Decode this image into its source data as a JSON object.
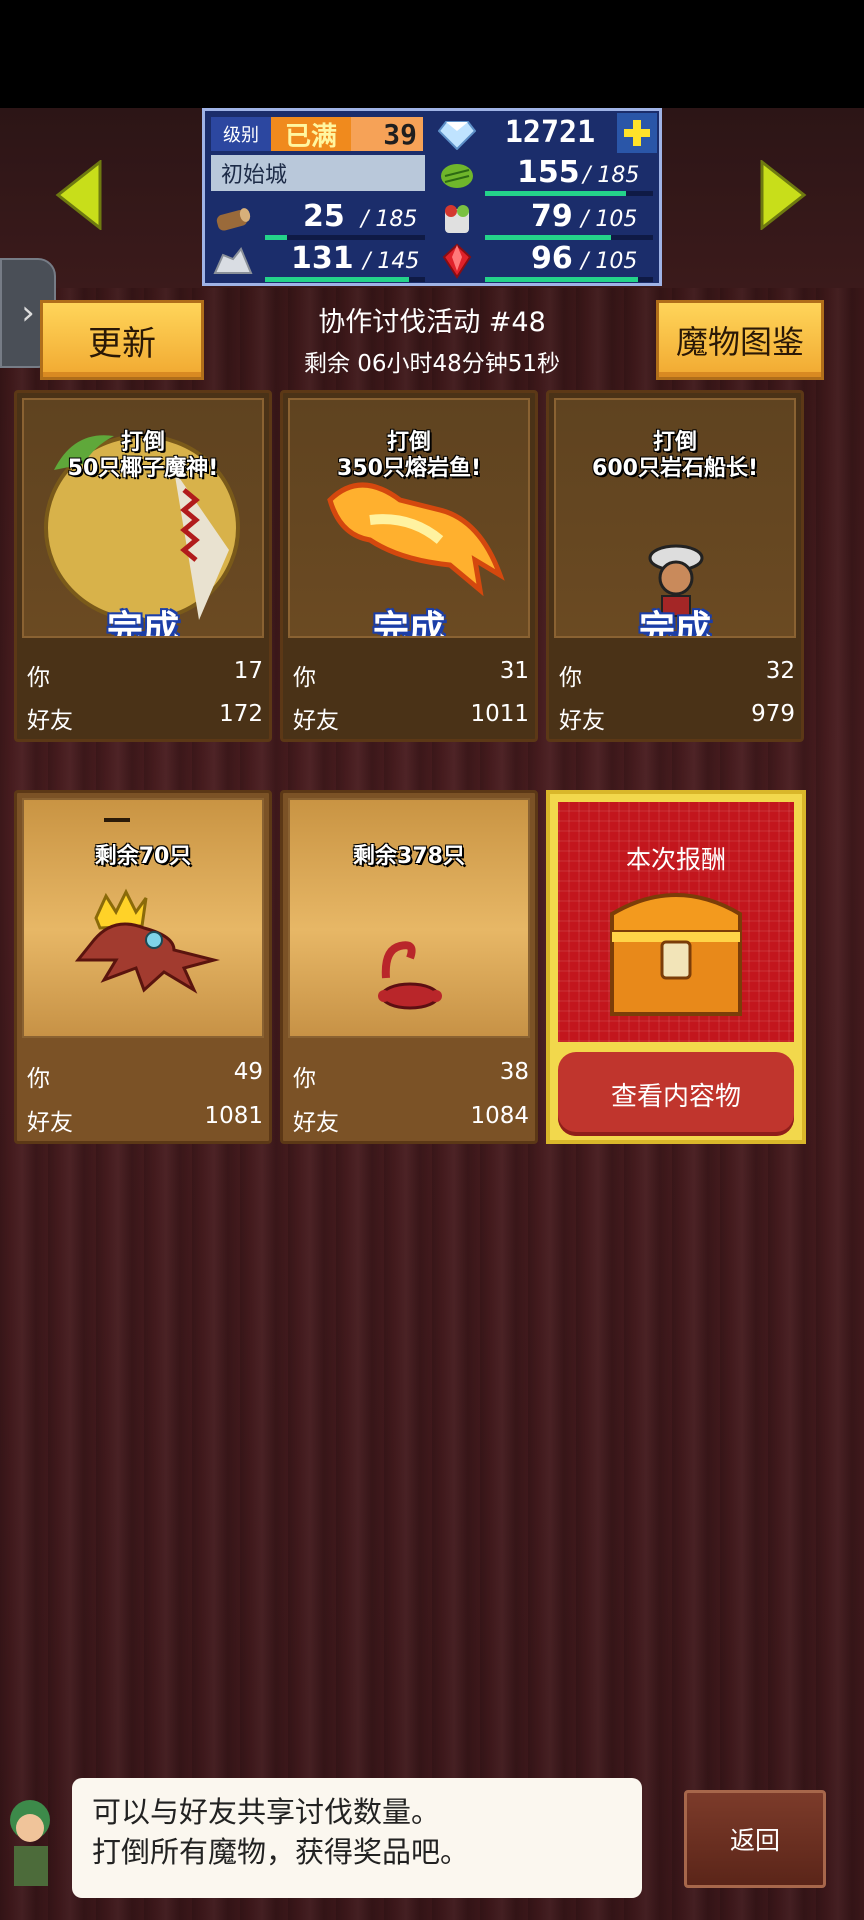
{
  "status_panel": {
    "level_label": "级别",
    "level_badge": "已满",
    "level_value": "39",
    "gems": "12721",
    "town_name": "初始城",
    "resources": [
      {
        "icon": "grass-icon",
        "value": "155",
        "max": "185",
        "fill": 0.84
      },
      {
        "icon": "wood-log-icon",
        "value": "25",
        "max": "185",
        "fill": 0.14
      },
      {
        "icon": "food-icon",
        "value": "79",
        "max": "105",
        "fill": 0.75
      },
      {
        "icon": "stone-icon",
        "value": "131",
        "max": "145",
        "fill": 0.9
      },
      {
        "icon": "ruby-icon",
        "value": "96",
        "max": "105",
        "fill": 0.91
      }
    ]
  },
  "header": {
    "refresh_button": "更新",
    "monster_book_button": "魔物图鉴",
    "event_title": "协作讨伐活动 #48",
    "event_timer": "剩余 06小时48分钟51秒"
  },
  "labels": {
    "you": "你",
    "friends": "好友",
    "done": "完成"
  },
  "cards_row1": [
    {
      "title_line1": "打倒",
      "title_line2": "50只椰子魔神!",
      "you": "17",
      "friends": "172",
      "monster": "coconut-monster-icon"
    },
    {
      "title_line1": "打倒",
      "title_line2": "350只熔岩鱼!",
      "you": "31",
      "friends": "1011",
      "monster": "lava-fish-icon"
    },
    {
      "title_line1": "打倒",
      "title_line2": "600只岩石船长!",
      "you": "32",
      "friends": "979",
      "monster": "rock-captain-icon"
    }
  ],
  "cards_row2": [
    {
      "title": "剩余70只",
      "you": "49",
      "friends": "1081",
      "monster": "crowned-octopus-icon"
    },
    {
      "title": "剩余378只",
      "you": "38",
      "friends": "1084",
      "monster": "scorpion-icon"
    }
  ],
  "reward": {
    "title": "本次报酬",
    "button": "查看内容物"
  },
  "dialog": {
    "line1": "可以与好友共享讨伐数量。",
    "line2": "打倒所有魔物，获得奖品吧。"
  },
  "back_button": "返回",
  "colors": {
    "gold_button": "#f1a931",
    "panel_blue": "#1b2d6b",
    "reward_red": "#c3161d",
    "bar_green": "#24d38a"
  }
}
